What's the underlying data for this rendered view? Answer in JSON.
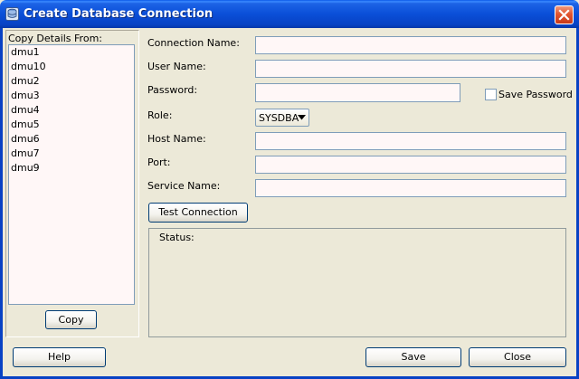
{
  "window": {
    "title": "Create Database Connection"
  },
  "left_panel": {
    "label": "Copy Details From:",
    "items": [
      "dmu1",
      "dmu10",
      "dmu2",
      "dmu3",
      "dmu4",
      "dmu5",
      "dmu6",
      "dmu7",
      "dmu9"
    ],
    "copy_label": "Copy"
  },
  "form": {
    "connection_name_label": "Connection Name:",
    "connection_name_value": "",
    "user_name_label": "User Name:",
    "user_name_value": "",
    "password_label": "Password:",
    "password_value": "",
    "save_password_label": "Save Password",
    "save_password_checked": false,
    "role_label": "Role:",
    "role_value": "SYSDBA",
    "host_name_label": "Host Name:",
    "host_name_value": "",
    "port_label": "Port:",
    "port_value": "",
    "service_name_label": "Service Name:",
    "service_name_value": "",
    "test_connection_label": "Test Connection",
    "status_label": "Status:",
    "status_value": ""
  },
  "footer": {
    "help_label": "Help",
    "save_label": "Save",
    "close_label": "Close"
  },
  "icons": {
    "title_icon": "database-connection-icon",
    "close_icon": "close-icon",
    "dropdown_icon": "chevron-down-icon"
  },
  "colors": {
    "title_bar": "#0a4fd8",
    "close_button": "#e2552f",
    "field_background": "#fff7f7",
    "dialog_background": "#ece9d8"
  }
}
